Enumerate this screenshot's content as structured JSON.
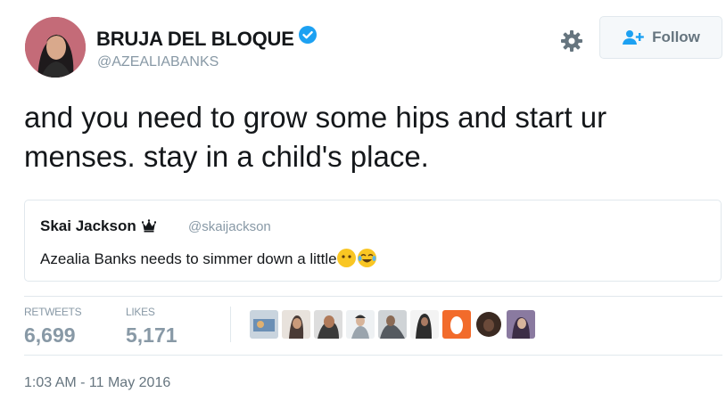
{
  "author": {
    "display_name": "BRUJA DEL BLOQUE",
    "handle": "@AZEALIABANKS",
    "verified": true,
    "avatar_icon": "profile-photo-avatar"
  },
  "header": {
    "settings_icon": "gear-icon",
    "follow_label": "Follow",
    "follow_icon": "add-user-icon"
  },
  "tweet": {
    "text": "and you need to grow some hips and start ur menses. stay in a child's place."
  },
  "quoted_tweet": {
    "name": "Skai Jackson",
    "badge_icon": "crown-icon",
    "handle": "@skaijackson",
    "text": "Azealia Banks needs to simmer down a little",
    "emojis": [
      "no-mouth-face-emoji",
      "tears-of-joy-emoji"
    ]
  },
  "stats": {
    "retweets_label": "RETWEETS",
    "retweets_value": "6,699",
    "likes_label": "LIKES",
    "likes_value": "5,171"
  },
  "likers": [
    {
      "name": "liker-avatar-1",
      "color": "#6b8fb5"
    },
    {
      "name": "liker-avatar-2",
      "color": "#4a3b36"
    },
    {
      "name": "liker-avatar-3",
      "color": "#3a3a3a"
    },
    {
      "name": "liker-avatar-4",
      "color": "#9aa4ad"
    },
    {
      "name": "liker-avatar-5",
      "color": "#555a60"
    },
    {
      "name": "liker-avatar-6",
      "color": "#2d2d2d"
    },
    {
      "name": "liker-avatar-7",
      "color": "#f26b2b"
    },
    {
      "name": "liker-avatar-8",
      "color": "#6b4a3a"
    },
    {
      "name": "liker-avatar-9",
      "color": "#8a7aa0"
    }
  ],
  "timestamp": "1:03 AM - 11 May 2016",
  "colors": {
    "verified_blue": "#1da1f2",
    "muted_gray": "#8899a6",
    "border": "#e1e8ed"
  }
}
